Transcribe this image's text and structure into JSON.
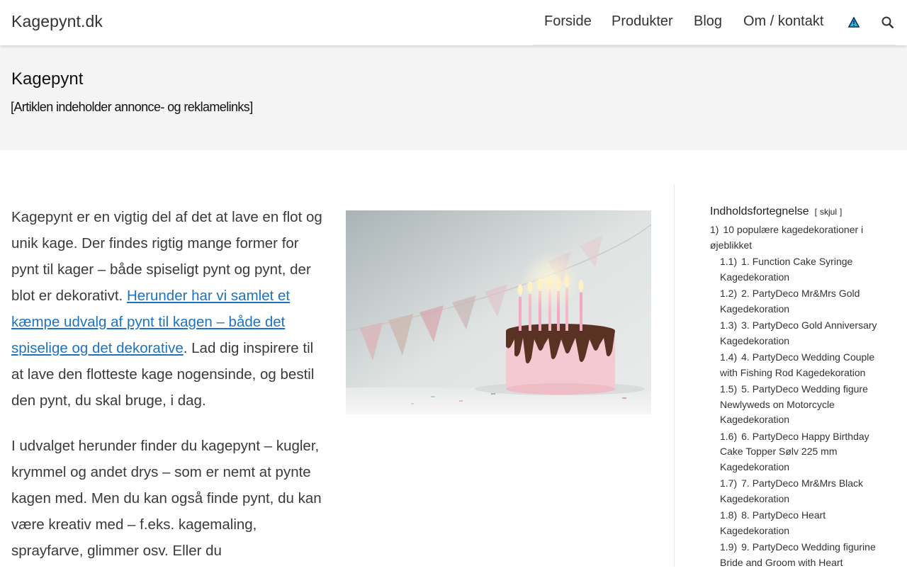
{
  "site": {
    "brand": "Kagepynt.dk"
  },
  "nav": {
    "items": [
      "Forside",
      "Produkter",
      "Blog",
      "Om / kontakt"
    ],
    "icons": [
      "warning-triangle-icon",
      "search-icon"
    ]
  },
  "hero": {
    "title": "Kagepynt",
    "note": "[Artiklen indeholder annonce- og reklamelinks]"
  },
  "article": {
    "p1_a": "Kagepynt er en vigtig del af det at lave en flot og unik kage. Der findes rigtig mange former for pynt til kager – både spiseligt pynt og pynt, der blot er dekorativt. ",
    "p1_link": "Herunder har vi samlet et kæmpe udvalg af pynt til kagen – både det spiselige og det dekorative",
    "p1_b": ". Lad dig inspirere til at lave den flotteste kage nogensinde, og bestil den pynt, du skal bruge, i dag.",
    "p2": "I udvalget herunder finder du kagepynt – kugler, krymmel og andet drys – som er nemt at pynte kagen med. Men du kan også finde pynt, du kan være kreativ med – f.eks. kagemaling, sprayfarve, glimmer osv. Eller du",
    "image_alt": "birthday-cake-photo"
  },
  "toc": {
    "title": "Indholdsfortegnelse",
    "toggle": "skjul",
    "items": [
      {
        "num": "1)",
        "label": "10 populære kagedekorationer i øjeblikket",
        "level": 1
      },
      {
        "num": "1.1)",
        "label": "1. Function Cake Syringe Kagedekoration",
        "level": 2
      },
      {
        "num": "1.2)",
        "label": "2. PartyDeco Mr&Mrs Gold Kagedekoration",
        "level": 2
      },
      {
        "num": "1.3)",
        "label": "3. PartyDeco Gold Anniversary Kagedekoration",
        "level": 2
      },
      {
        "num": "1.4)",
        "label": "4. PartyDeco Wedding Couple with Fishing Rod Kagedekoration",
        "level": 2
      },
      {
        "num": "1.5)",
        "label": "5. PartyDeco Wedding figure Newlyweds on Motorcycle Kagedekoration",
        "level": 2
      },
      {
        "num": "1.6)",
        "label": "6. PartyDeco Happy Birthday Cake Topper Sølv 225 mm Kagedekoration",
        "level": 2
      },
      {
        "num": "1.7)",
        "label": "7. PartyDeco Mr&Mrs Black Kagedekoration",
        "level": 2
      },
      {
        "num": "1.8)",
        "label": "8. PartyDeco Heart Kagedekoration",
        "level": 2
      },
      {
        "num": "1.9)",
        "label": "9. PartyDeco Wedding figurine Bride and Groom with Heart",
        "level": 2
      }
    ]
  },
  "colors": {
    "link": "#1e73be",
    "hero_bg": "#f4f4f4",
    "text": "#3a3a3a"
  }
}
